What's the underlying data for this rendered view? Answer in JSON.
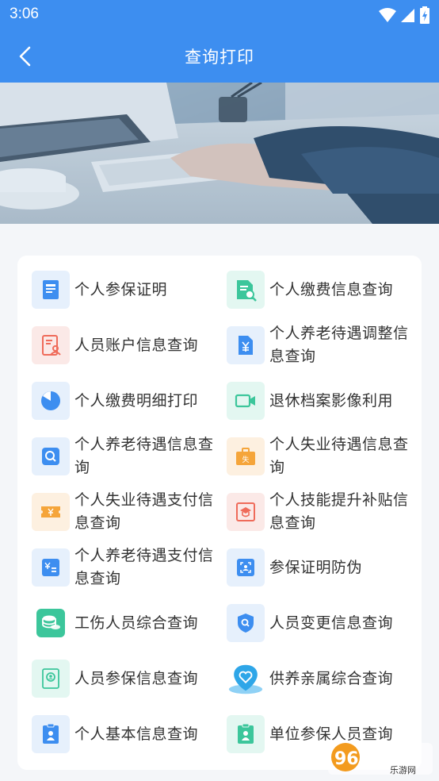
{
  "status": {
    "time": "3:06"
  },
  "header": {
    "title": "查询打印"
  },
  "items": [
    {
      "label": "个人参保证明",
      "icon": "certificate-icon"
    },
    {
      "label": "个人缴费信息查询",
      "icon": "payment-search-icon"
    },
    {
      "label": "人员账户信息查询",
      "icon": "account-icon"
    },
    {
      "label": "个人养老待遇调整信息查询",
      "icon": "yuan-document-icon"
    },
    {
      "label": "个人缴费明细打印",
      "icon": "pie-chart-icon"
    },
    {
      "label": "退休档案影像利用",
      "icon": "video-icon"
    },
    {
      "label": "个人养老待遇信息查询",
      "icon": "search-icon"
    },
    {
      "label": "个人失业待遇信息查询",
      "icon": "briefcase-icon"
    },
    {
      "label": "个人失业待遇支付信息查询",
      "icon": "ticket-icon"
    },
    {
      "label": "个人技能提升补贴信息查询",
      "icon": "graduation-cap-icon"
    },
    {
      "label": "个人养老待遇支付信息查询",
      "icon": "yuan-card-icon"
    },
    {
      "label": "参保证明防伪",
      "icon": "scan-icon"
    },
    {
      "label": "工伤人员综合查询",
      "icon": "coins-icon"
    },
    {
      "label": "人员变更信息查询",
      "icon": "shield-search-icon"
    },
    {
      "label": "人员参保信息查询",
      "icon": "person-card-icon"
    },
    {
      "label": "供养亲属综合查询",
      "icon": "heart-location-icon"
    },
    {
      "label": "个人基本信息查询",
      "icon": "person-badge-icon"
    },
    {
      "label": "单位参保人员查询",
      "icon": "id-badge-icon"
    }
  ],
  "watermark": {
    "text": "962.NET",
    "subtext": "乐游网"
  },
  "colors": {
    "primary": "#3d8ef0",
    "green": "#3cc69b",
    "red": "#ef6b5a",
    "orange": "#f5a53a"
  }
}
